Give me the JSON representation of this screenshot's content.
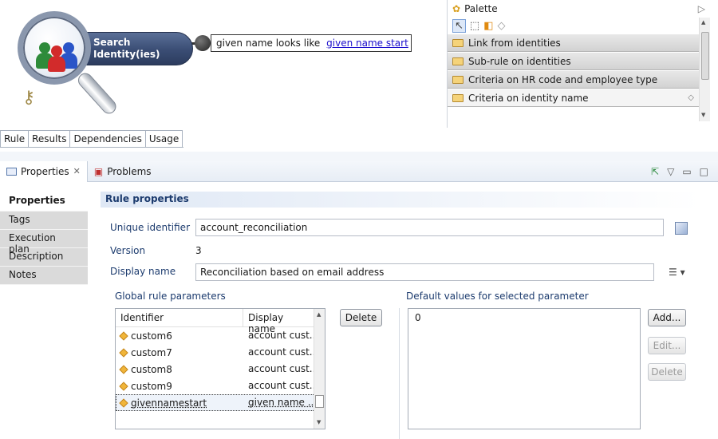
{
  "canvas": {
    "search_node_line1": "Search",
    "search_node_line2": "Identity(ies)",
    "criterion_text": "given name looks like",
    "criterion_link": "given name start"
  },
  "palette": {
    "title": "Palette",
    "drawers": [
      {
        "label": "Link from identities"
      },
      {
        "label": "Sub-rule on identities"
      },
      {
        "label": "Criteria on HR code and employee type"
      },
      {
        "label": "Criteria on identity name"
      }
    ]
  },
  "editor_tabs": [
    "Rule",
    "Results",
    "Dependencies",
    "Usage"
  ],
  "view": {
    "tabs": [
      {
        "label": "Properties"
      },
      {
        "label": "Problems"
      }
    ]
  },
  "sidebar": {
    "items": [
      {
        "label": "Properties"
      },
      {
        "label": "Tags"
      },
      {
        "label": "Execution plan"
      },
      {
        "label": "Description"
      },
      {
        "label": "Notes"
      }
    ]
  },
  "rule": {
    "section_title": "Rule properties",
    "uid_label": "Unique identifier",
    "uid_value": "account_reconciliation",
    "version_label": "Version",
    "version_value": "3",
    "display_label": "Display name",
    "display_value": "Reconciliation based on email address"
  },
  "params": {
    "group_label": "Global rule parameters",
    "headers": {
      "identifier": "Identifier",
      "display": "Display name"
    },
    "rows": [
      {
        "identifier": "custom6",
        "display": "account cust..."
      },
      {
        "identifier": "custom7",
        "display": "account cust..."
      },
      {
        "identifier": "custom8",
        "display": "account cust..."
      },
      {
        "identifier": "custom9",
        "display": "account cust..."
      },
      {
        "identifier": "givennamestart",
        "display": "given name ..."
      }
    ],
    "delete_label": "Delete"
  },
  "defaults": {
    "group_label": "Default values for selected parameter",
    "value": "0",
    "add_label": "Add...",
    "edit_label": "Edit...",
    "delete_label": "Delete"
  },
  "colors": {
    "accent": "#1c3b6e",
    "node": "#3a4d74",
    "link": "#1a0dcc"
  }
}
